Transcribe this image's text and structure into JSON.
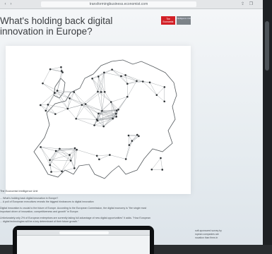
{
  "browser": {
    "url": "transformingbusiness.economist.com"
  },
  "article": {
    "headline": "What's holding back digital innovation in Europe?",
    "brand": "The Economist",
    "brand_sub": "Intelligence Unit",
    "caption": "The Economist Intelligence Unit",
    "lines": [
      "... What's holding back digital innovation in Europe?",
      "... A poll of European executives reveals the biggest hindrances to digital innovation",
      "Digital innovation is crucial to the future of Europe. According to the European Commission, the digital economy is \"the single most",
      "important driver of innovation, competitiveness and growth\" in Europe.",
      "Unfortunately only 2% of European enterprises are currently taking full advantage of new digital opportunities\" it adds. \"How European",
      "... digital technologies will be a key determinant of their future growth.\""
    ],
    "side_lines": [
      "soft-sponsored survey by",
      "ropean companies are",
      "novation than firms in"
    ]
  },
  "icons": {
    "share": "share-icon",
    "tabs": "tabs-icon",
    "nav": "chevron-icon"
  }
}
